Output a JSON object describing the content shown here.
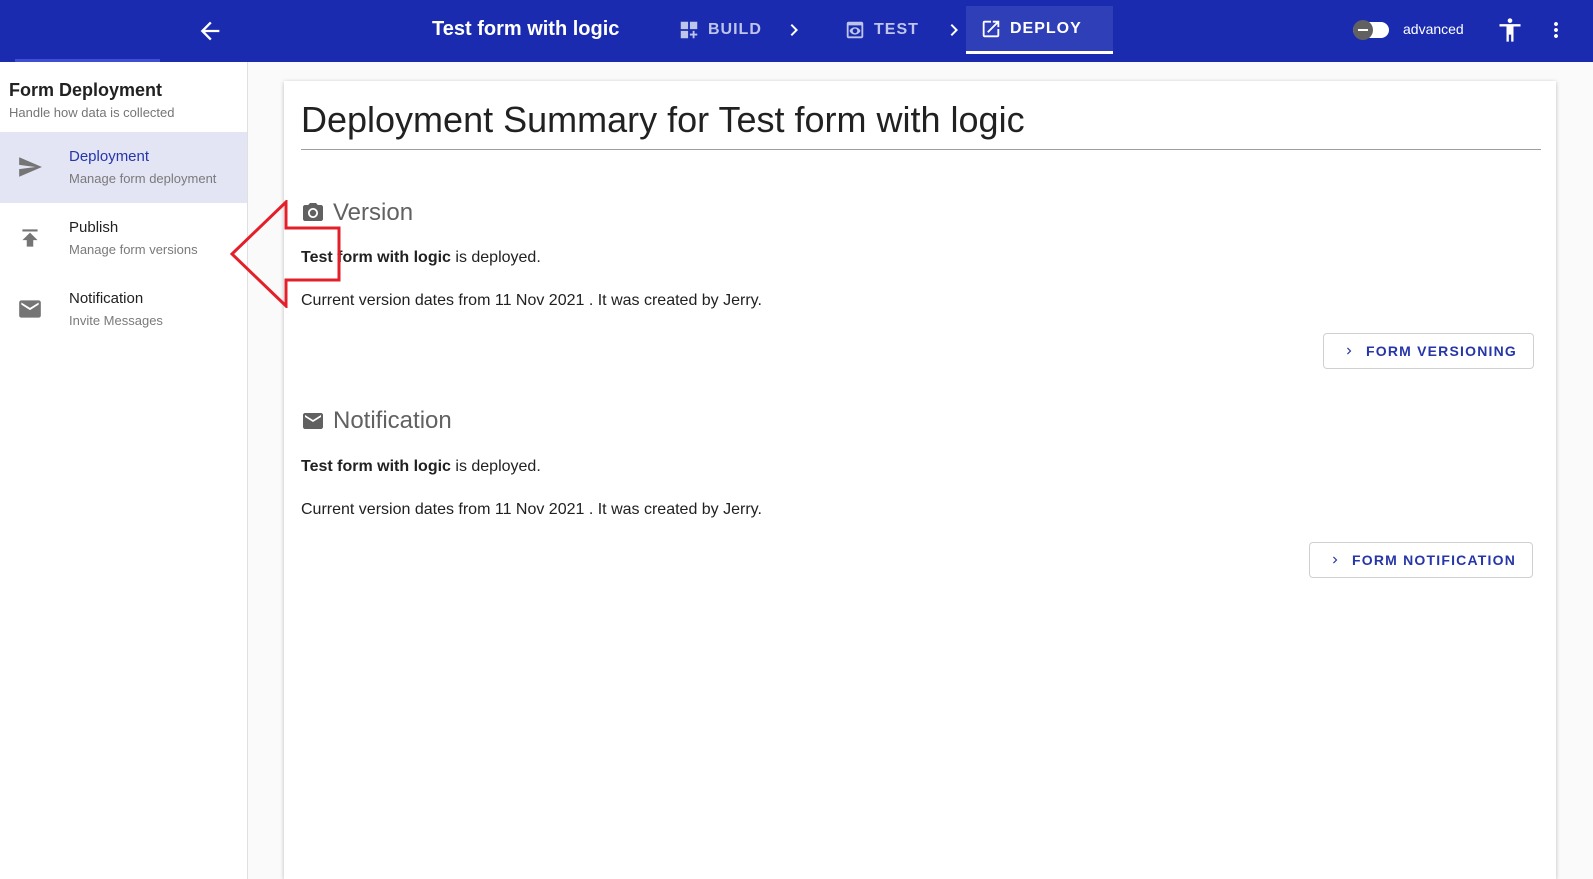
{
  "header": {
    "title": "Test form with logic",
    "steps": [
      {
        "label": "BUILD",
        "icon": "dashboard-add-icon"
      },
      {
        "label": "TEST",
        "icon": "preview-icon"
      },
      {
        "label": "DEPLOY",
        "icon": "open-in-new-icon"
      }
    ],
    "active_step": "DEPLOY",
    "advanced_label": "advanced",
    "advanced_enabled": false,
    "colors": {
      "bar": "#1a2bb0",
      "active_step": "#2f3fb8"
    }
  },
  "sidebar": {
    "title": "Form Deployment",
    "subtitle": "Handle how data is collected",
    "items": [
      {
        "label": "Deployment",
        "description": "Manage form deployment",
        "icon": "send-icon",
        "active": true
      },
      {
        "label": "Publish",
        "description": "Manage form versions",
        "icon": "publish-icon",
        "active": false
      },
      {
        "label": "Notification",
        "description": "Invite Messages",
        "icon": "mail-icon",
        "active": false
      }
    ]
  },
  "main": {
    "title": "Deployment Summary for Test form with logic",
    "sections": [
      {
        "heading": "Version",
        "icon": "camera-icon",
        "form_name": "Test form with logic",
        "deployed_text": " is deployed.",
        "version_text": "Current version dates from 11 Nov 2021 . It was created by Jerry.",
        "button_label": "FORM VERSIONING"
      },
      {
        "heading": "Notification",
        "icon": "mail-icon",
        "form_name": "Test form with logic",
        "deployed_text": " is deployed.",
        "version_text": "Current version dates from 11 Nov 2021 . It was created by Jerry.",
        "button_label": "FORM NOTIFICATION"
      }
    ]
  },
  "annotation": {
    "color": "#e3202a",
    "shape": "arrow-left"
  }
}
